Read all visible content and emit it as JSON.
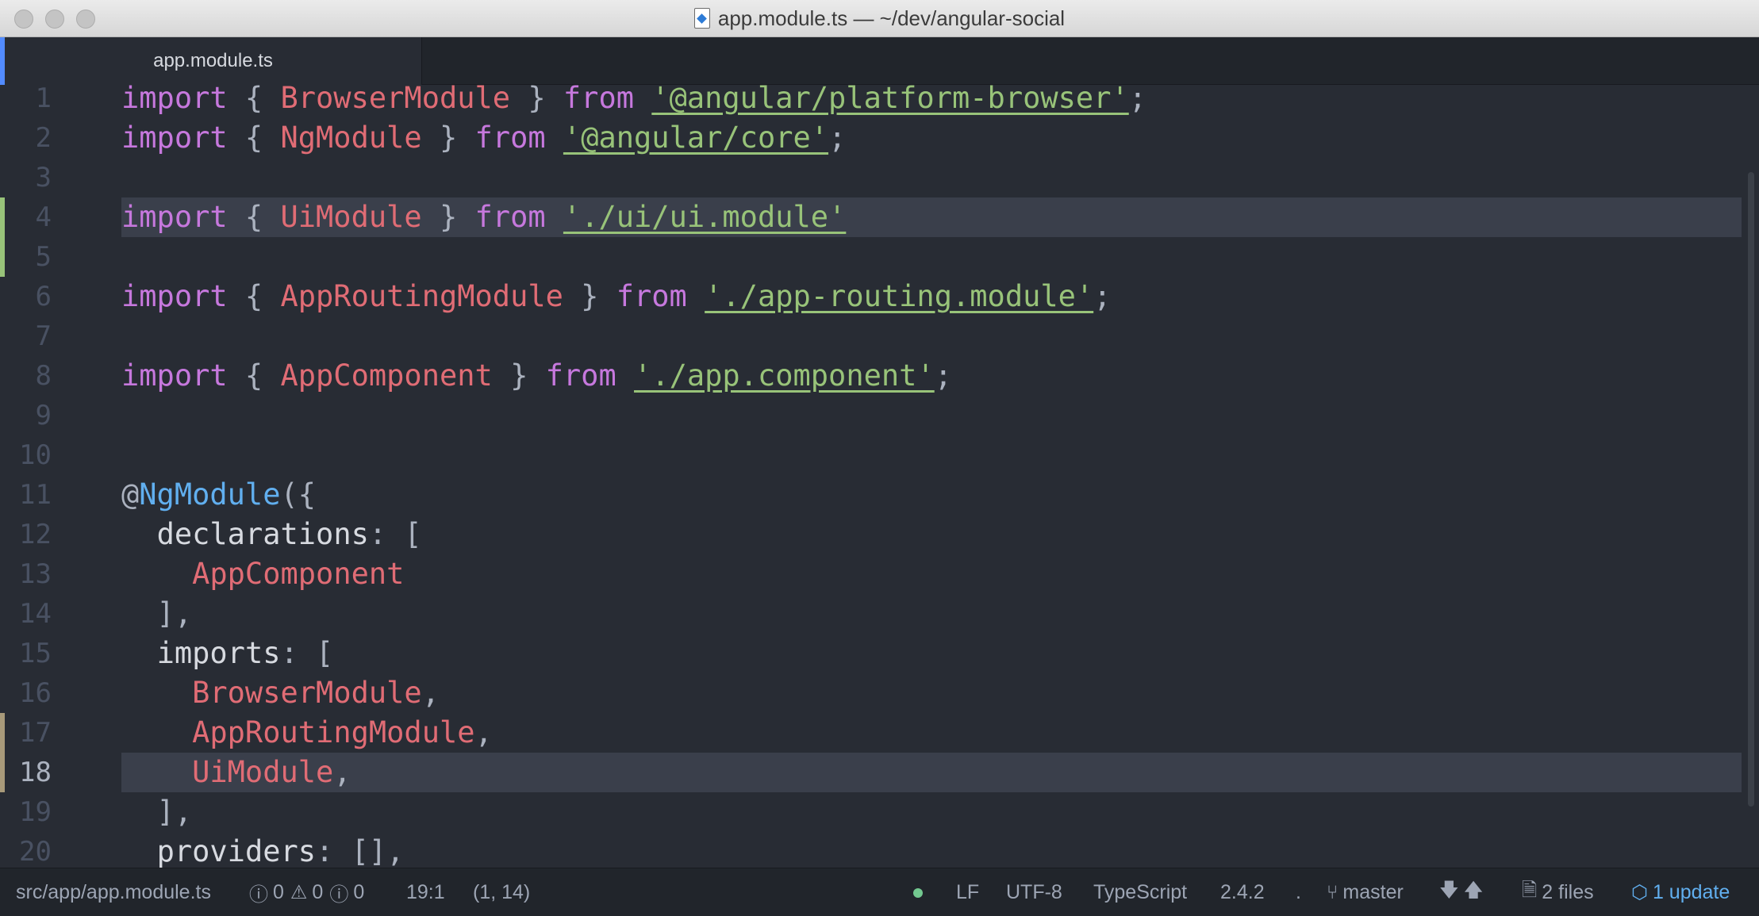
{
  "window": {
    "title": "app.module.ts — ~/dev/angular-social"
  },
  "tabs": [
    {
      "label": "app.module.ts"
    }
  ],
  "editor": {
    "lines": [
      {
        "n": "1",
        "tokens": [
          [
            "kw",
            "import"
          ],
          [
            "p",
            " { "
          ],
          [
            "cls",
            "BrowserModule"
          ],
          [
            "p",
            " } "
          ],
          [
            "kw",
            "from"
          ],
          [
            "p",
            " "
          ],
          [
            "str",
            "'@angular/platform-browser'"
          ],
          [
            "p",
            ";"
          ]
        ]
      },
      {
        "n": "2",
        "tokens": [
          [
            "kw",
            "import"
          ],
          [
            "p",
            " { "
          ],
          [
            "cls",
            "NgModule"
          ],
          [
            "p",
            " } "
          ],
          [
            "kw",
            "from"
          ],
          [
            "p",
            " "
          ],
          [
            "str",
            "'@angular/core'"
          ],
          [
            "p",
            ";"
          ]
        ]
      },
      {
        "n": "3",
        "tokens": []
      },
      {
        "n": "4",
        "tokens": [
          [
            "kw",
            "import"
          ],
          [
            "p",
            " { "
          ],
          [
            "cls",
            "UiModule"
          ],
          [
            "p",
            " } "
          ],
          [
            "kw",
            "from"
          ],
          [
            "p",
            " "
          ],
          [
            "str",
            "'./ui/ui.module'"
          ]
        ],
        "highlight": true,
        "marker": "#98c379"
      },
      {
        "n": "5",
        "tokens": [],
        "marker": "#98c379"
      },
      {
        "n": "6",
        "tokens": [
          [
            "kw",
            "import"
          ],
          [
            "p",
            " { "
          ],
          [
            "cls",
            "AppRoutingModule"
          ],
          [
            "p",
            " } "
          ],
          [
            "kw",
            "from"
          ],
          [
            "p",
            " "
          ],
          [
            "str",
            "'./app-routing.module'"
          ],
          [
            "p",
            ";"
          ]
        ]
      },
      {
        "n": "7",
        "tokens": []
      },
      {
        "n": "8",
        "tokens": [
          [
            "kw",
            "import"
          ],
          [
            "p",
            " { "
          ],
          [
            "cls",
            "AppComponent"
          ],
          [
            "p",
            " } "
          ],
          [
            "kw",
            "from"
          ],
          [
            "p",
            " "
          ],
          [
            "str",
            "'./app.component'"
          ],
          [
            "p",
            ";"
          ]
        ]
      },
      {
        "n": "9",
        "tokens": []
      },
      {
        "n": "10",
        "tokens": []
      },
      {
        "n": "11",
        "tokens": [
          [
            "p",
            "@"
          ],
          [
            "fn",
            "NgModule"
          ],
          [
            "p",
            "({"
          ]
        ]
      },
      {
        "n": "12",
        "tokens": [
          [
            "p",
            "  "
          ],
          [
            "key",
            "declarations"
          ],
          [
            "p",
            ": ["
          ]
        ]
      },
      {
        "n": "13",
        "tokens": [
          [
            "p",
            "    "
          ],
          [
            "cls",
            "AppComponent"
          ]
        ]
      },
      {
        "n": "14",
        "tokens": [
          [
            "p",
            "  ],"
          ]
        ]
      },
      {
        "n": "15",
        "tokens": [
          [
            "p",
            "  "
          ],
          [
            "key",
            "imports"
          ],
          [
            "p",
            ": ["
          ]
        ]
      },
      {
        "n": "16",
        "tokens": [
          [
            "p",
            "    "
          ],
          [
            "cls",
            "BrowserModule"
          ],
          [
            "p",
            ","
          ]
        ]
      },
      {
        "n": "17",
        "tokens": [
          [
            "p",
            "    "
          ],
          [
            "cls",
            "AppRoutingModule"
          ],
          [
            "p",
            ","
          ]
        ],
        "marker": "#a89a7a"
      },
      {
        "n": "18",
        "tokens": [
          [
            "p",
            "    "
          ],
          [
            "cls",
            "UiModule"
          ],
          [
            "p",
            ","
          ]
        ],
        "highlight": true,
        "active": true,
        "marker": "#a89a7a"
      },
      {
        "n": "19",
        "tokens": [
          [
            "p",
            "  ],"
          ]
        ]
      },
      {
        "n": "20",
        "tokens": [
          [
            "p",
            "  "
          ],
          [
            "key",
            "providers"
          ],
          [
            "p",
            ": [],"
          ]
        ]
      }
    ]
  },
  "status": {
    "path": "src/app/app.module.ts",
    "errors": "0",
    "warnings": "0",
    "infos": "0",
    "cursor": "19:1",
    "selection": "(1, 14)",
    "line_ending": "LF",
    "encoding": "UTF-8",
    "grammar": "TypeScript",
    "version": "2.4.2",
    "dot_sep": ".",
    "branch": "master",
    "files": "2 files",
    "update": "1 update"
  },
  "colors": {
    "keyword": "#c678dd",
    "class": "#e06c75",
    "string": "#98c379",
    "function": "#61afef",
    "background": "#282c34"
  }
}
